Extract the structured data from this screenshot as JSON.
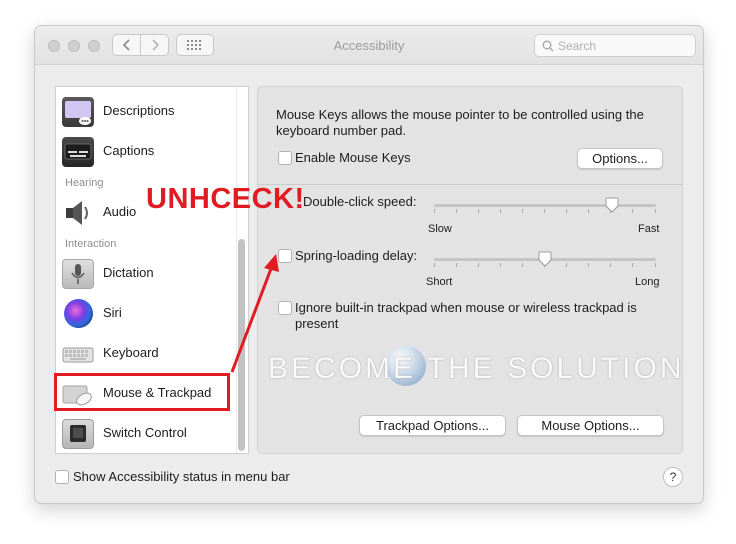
{
  "window": {
    "title": "Accessibility",
    "search_placeholder": "Search"
  },
  "sidebar": {
    "items": [
      {
        "label": "Descriptions",
        "icon": "descriptions-icon"
      },
      {
        "label": "Captions",
        "icon": "captions-icon"
      },
      {
        "label": "Audio",
        "icon": "speaker-icon"
      },
      {
        "label": "Dictation",
        "icon": "microphone-icon"
      },
      {
        "label": "Siri",
        "icon": "siri-icon"
      },
      {
        "label": "Keyboard",
        "icon": "keyboard-icon"
      },
      {
        "label": "Mouse & Trackpad",
        "icon": "trackpad-mouse-icon",
        "selected": true
      },
      {
        "label": "Switch Control",
        "icon": "switch-control-icon"
      }
    ],
    "sections": {
      "hearing": "Hearing",
      "interaction": "Interaction"
    }
  },
  "panel": {
    "mouse_keys_description": "Mouse Keys allows the mouse pointer to be controlled using the keyboard number pad.",
    "enable_mouse_keys": {
      "label": "Enable Mouse Keys",
      "checked": false
    },
    "options_button": "Options...",
    "double_click": {
      "label": "Double-click speed:",
      "min_label": "Slow",
      "max_label": "Fast",
      "value": 0.8
    },
    "spring_loading": {
      "label": "Spring-loading delay:",
      "min_label": "Short",
      "max_label": "Long",
      "checked": false,
      "value": 0.5
    },
    "ignore_trackpad": {
      "label": "Ignore built-in trackpad when mouse or wireless trackpad is present",
      "checked": false
    },
    "trackpad_options_button": "Trackpad Options...",
    "mouse_options_button": "Mouse Options..."
  },
  "footer": {
    "show_status": {
      "label": "Show Accessibility status in menu bar",
      "checked": false
    },
    "help": "?"
  },
  "annotation": {
    "callout": "UNHCECK!",
    "color": "#e11b22"
  },
  "watermark": "BECOME THE SOLUTION"
}
